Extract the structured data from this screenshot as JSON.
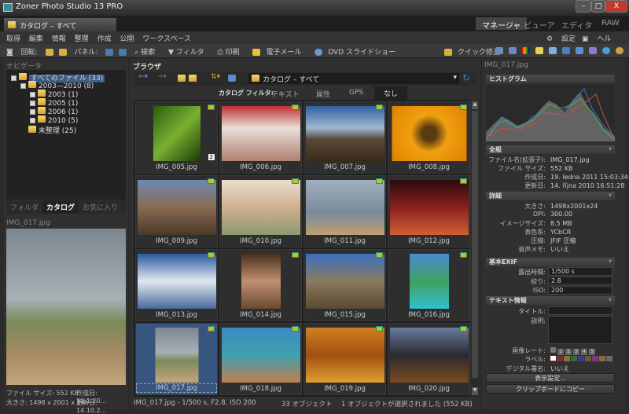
{
  "window": {
    "title": "Zoner Photo Studio 13 PRO",
    "min": "–",
    "max": "□",
    "close": "X"
  },
  "doc_tab": "カタログ – すべて",
  "modes": [
    "マネージャ",
    "ビューア",
    "エディタ",
    "RAW"
  ],
  "menu": [
    "取得",
    "編集",
    "情報",
    "整理",
    "作成",
    "公開",
    "ワークスペース"
  ],
  "menu_right": {
    "settings": "設定",
    "help": "ヘルプ"
  },
  "toolbar": {
    "rotate": "回転:",
    "panel": "パネル:",
    "search": "検索",
    "filter": "フィルタ",
    "print": "印刷",
    "email": "電子メール",
    "dvd": "DVD スライドショー",
    "quickfix": "クイック修正"
  },
  "navigator": {
    "title": "ナビゲータ",
    "tree": [
      {
        "label": "すべてのファイル (33)"
      },
      {
        "label": "2003—2010 (8)"
      },
      {
        "label": "2003 (1)"
      },
      {
        "label": "2005 (1)"
      },
      {
        "label": "2006 (1)"
      },
      {
        "label": "2010 (5)"
      },
      {
        "label": "未整理 (25)"
      }
    ],
    "tabs": [
      "フォルダ",
      "カタログ",
      "お気に入り"
    ]
  },
  "preview": {
    "title": "IMG_017.jpg",
    "filesize": "ファイル サイズ: 552 KB",
    "created": "作成日: 19.1.20...",
    "dims": "大きさ: 1498 x 2001 x 24",
    "modified": "更新日: 14.10.2..."
  },
  "browser": {
    "title": "ブラウザ",
    "path": "カタログ – すべて",
    "filter_label": "カタログ フィルタ:",
    "filters": [
      "テキスト",
      "属性",
      "GPS",
      "なし"
    ],
    "items": [
      "IMG_005.jpg",
      "IMG_006.jpg",
      "IMG_007.jpg",
      "IMG_008.jpg",
      "IMG_009.jpg",
      "IMG_010.jpg",
      "IMG_011.jpg",
      "IMG_012.jpg",
      "IMG_013.jpg",
      "IMG_014.jpg",
      "IMG_015.jpg",
      "IMG_016.jpg",
      "IMG_017.jpg",
      "IMG_018.jpg",
      "IMG_019.jpg",
      "IMG_020.jpg"
    ],
    "first_badge": "2",
    "status": {
      "info": "IMG_017.jpg - 1/500 s, F2.8, ISO 200",
      "count": "33 オブジェクト",
      "selected": "1 オブジェクトが選択されました (552 KB)"
    }
  },
  "props": {
    "title": "IMG_017.jpg",
    "histogram": "ヒストグラム",
    "general": {
      "title": "全般",
      "rows": [
        [
          "ファイル名(拡張子):",
          "IMG_017.jpg"
        ],
        [
          "ファイル サイズ:",
          "552 KB"
        ],
        [
          "作成日:",
          "19. ledna 2011 15:03:34"
        ],
        [
          "更新日:",
          "14. října 2010 16:51:28"
        ]
      ]
    },
    "details": {
      "title": "詳細",
      "rows": [
        [
          "大きさ:",
          "1498x2001x24"
        ],
        [
          "DPI:",
          "300.00"
        ],
        [
          "イメージサイズ:",
          "8.5 MB"
        ],
        [
          "表色系:",
          "YCbCR"
        ],
        [
          "圧縮:",
          "JFIF 圧縮"
        ],
        [
          "音声メモ:",
          "いいえ"
        ]
      ]
    },
    "exif": {
      "title": "基本EXIF",
      "rows": [
        [
          "露出時間:",
          "1/500 s"
        ],
        [
          "絞り:",
          "2.8"
        ],
        [
          "ISO:",
          "200"
        ]
      ]
    },
    "text": {
      "title": "テキスト情報",
      "title_label": "タイトル:",
      "desc_label": "説明:",
      "rating_label": "画像レート:",
      "ratings": [
        "1",
        "2",
        "3",
        "4",
        "5"
      ],
      "label_label": "ラベル:",
      "sign_label": "デジタル署名:",
      "sign_value": "いいえ"
    },
    "label_colors": [
      "#7a3030",
      "#7a7a30",
      "#3a6a3a",
      "#3a3a8a",
      "#6a5a3a",
      "#7a3a7a",
      "#8a6a3a",
      "#6a6a6a"
    ],
    "buttons": {
      "display": "表示設定...",
      "copy": "クリップボードにコピー"
    }
  }
}
